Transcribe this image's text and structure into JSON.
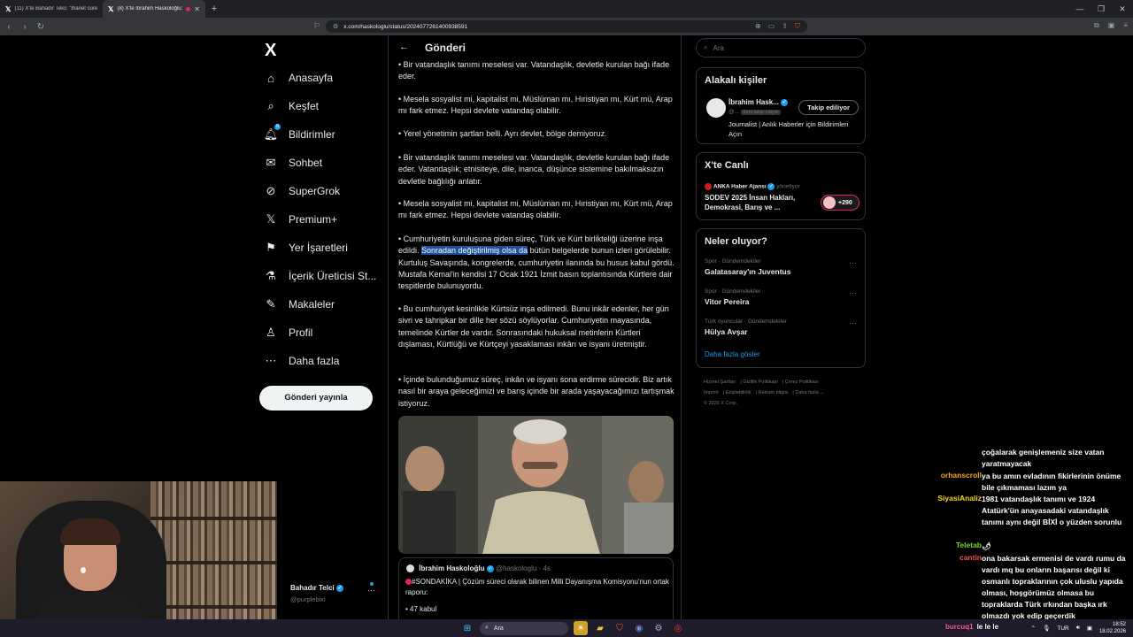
{
  "browser": {
    "tabs": [
      {
        "title": "(11) X'te Bahadır Telci: \"İhanet süreci...",
        "active": false
      },
      {
        "title": "(8) X'te İbrahim Haskoloğlu: \"",
        "active": true
      }
    ],
    "url": "x.com/haskologlu/status/2024077261400938591"
  },
  "sidebar": {
    "logo": "X",
    "items": [
      {
        "label": "Anasayfa",
        "icon": "home-icon"
      },
      {
        "label": "Keşfet",
        "icon": "search-icon"
      },
      {
        "label": "Bildirimler",
        "icon": "bell-icon",
        "badge": "8"
      },
      {
        "label": "Sohbet",
        "icon": "mail-icon"
      },
      {
        "label": "SuperGrok",
        "icon": "grok-icon"
      },
      {
        "label": "Premium+",
        "icon": "x-icon"
      },
      {
        "label": "Yer İşaretleri",
        "icon": "bookmark-icon"
      },
      {
        "label": "İçerik Üreticisi St...",
        "icon": "creator-icon"
      },
      {
        "label": "Makaleler",
        "icon": "article-icon"
      },
      {
        "label": "Profil",
        "icon": "person-icon"
      },
      {
        "label": "Daha fazla",
        "icon": "more-icon"
      }
    ],
    "post_button": "Gönderi yayınla",
    "profile": {
      "name": "Bahadır Telci",
      "handle": "@purplebixi"
    }
  },
  "main": {
    "title": "Gönderi",
    "paragraphs": [
      "• Bir vatandaşlık tanımı meselesi var. Vatandaşlık, devletle kurulan bağı ifade eder.",
      "• Mesela sosyalist mi, kapitalist mi, Müslüman mı, Hıristiyan mı, Kürt mü, Arap mı fark etmez. Hepsi devlete vatandaş olabilir.",
      "• Yerel yönetimin şartları belli. Ayrı devlet, bölge demiyoruz.",
      "• Bir vatandaşlık tanımı meselesi var. Vatandaşlık, devletle kurulan bağı ifade eder. Vatandaşlık; etnisiteye, dile, inanca, düşünce sistemine bakılmaksızın devletle bağlılığı anlatır.",
      "• Mesela sosyalist mi, kapitalist mi, Müslüman mı, Hıristiyan mı, Kürt mü, Arap mı fark etmez. Hepsi devlete vatandaş olabilir."
    ],
    "p6": {
      "before": "• Cumhuriyetin kuruluşuna giden süreç, Türk ve Kürt birlikteliği üzerine inşa edildi. ",
      "highlight": "Sonradan değiştirilmiş olsa da",
      "after": " bütün belgelerde bunun izleri görülebilir. Kurtuluş Savaşında, kongrelerde, cumhuriyetin ilanında bu husus kabul gördü. Mustafa Kemal'in kendisi 17 Ocak 1921 İzmit basın toplantısında Kürtlere dair tespitlerde bulunuyordu."
    },
    "p7": "• Bu cumhuriyet kesinlikle Kürtsüz inşa edilmedi. Bunu inkâr edenler, her gün sivri ve tahripkar bir dille her sözü söylüyorlar. Cumhuriyetin mayasında, temelinde Kürtler de vardır. Sonrasındaki hukuksal metinlerin Kürtleri dışlaması, Kürtlüğü ve Kürtçeyi yasaklaması inkârı ve isyanı üretmiştir.",
    "p8": "• İçinde bulunduğumuz süreç, inkân ve isyanı sona erdirme sürecidir. Biz artık nasıl bir araya geleceğimizi ve barış içinde bir arada yaşayacağımızı tartışmak istiyoruz.",
    "quote": {
      "name": "İbrahim Haskoloğlu",
      "handle": "@haskologlu · 4s",
      "text": "#SONDAKİKA | Çözüm süreci olarak bilinen Milli Dayanışma Komisyonu'nun ortak raporu:",
      "bullet": "• 47 kabul"
    }
  },
  "right": {
    "search_placeholder": "Ara",
    "related": {
      "title": "Alakalı kişiler",
      "name": "İbrahim Hask...",
      "handle": "@...",
      "follows_you": "Seni takip ediyor",
      "button": "Takip ediliyor",
      "bio": "Journalist | Anlık Haberler için Bildirimleri Açın"
    },
    "live": {
      "title": "X'te Canlı",
      "host": "ANKA Haber Ajansı",
      "role": "yönetiyor",
      "stream_title": "SODEV 2025 İnsan Hakları, Demokrasi, Barış ve ...",
      "count": "+290"
    },
    "trends": {
      "title": "Neler oluyor?",
      "items": [
        {
          "context": "Spor · Gündemdekiler",
          "name": "Galatasaray'ın Juventus"
        },
        {
          "context": "Spor · Gündemdekiler",
          "name": "Vitor Pereira"
        },
        {
          "context": "Türk oyuncular · Gündemdekiler",
          "name": "Hülya Avşar"
        }
      ],
      "show_more": "Daha fazla göster"
    },
    "footer": [
      "Hizmet Şartları",
      "Gizlilik Politikası",
      "Çerez Politikası",
      "İmprint",
      "Erişilebilirlik",
      "Reklam bilgisi",
      "Daha fazla ...",
      "© 2026 X Corp."
    ]
  },
  "chat": [
    {
      "user": "",
      "color": "#ffffff",
      "text": "çoğalarak genişlemeniz size vatan yaratmayacak"
    },
    {
      "user": "orhanscroll",
      "color": "#f5a623",
      "text": "ya bu amın evladının fikirlerinin önüme bile çıkmaması lazım ya"
    },
    {
      "user": "SiyasiAnaliz",
      "color": "#f5d623",
      "text": "1981 vatandaşlık tanımı ve 1924 Atatürk'ün anayasadaki vatandaşlık tanımı aynı değil BİXİ o yüzden sorunlu"
    },
    {
      "user": "Teletab",
      "color": "#7ed321",
      "text": "🌶"
    },
    {
      "user": "cantin",
      "color": "#ff4a4a",
      "text": "ona bakarsak ermenisi de vardı rumu da vardı mq bu onların başarısı değil ki osmanlı topraklarının çok uluslu yapıda olması, hoşgörümüz olmasa bu topraklarda Türk ırkından başka ırk olmazdı yok edip geçerdik"
    }
  ],
  "taskbar": {
    "search": "Ara",
    "user": "burcuq1",
    "user_msg": "le le le",
    "lang": "TUR",
    "time": "18:52",
    "date": "18.02.2026"
  }
}
